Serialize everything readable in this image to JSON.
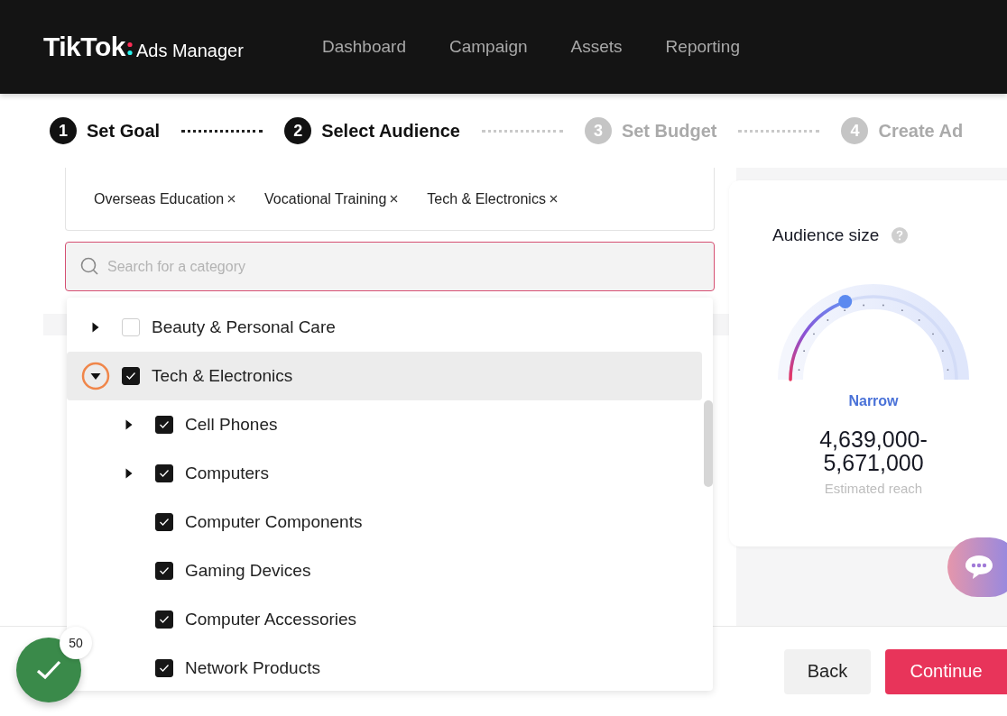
{
  "header": {
    "logo": "TikTok",
    "product": "Ads Manager",
    "nav": [
      {
        "label": "Dashboard"
      },
      {
        "label": "Campaign"
      },
      {
        "label": "Assets"
      },
      {
        "label": "Reporting"
      }
    ]
  },
  "steps": [
    {
      "number": "1",
      "label": "Set Goal",
      "active": true
    },
    {
      "number": "2",
      "label": "Select Audience",
      "active": true
    },
    {
      "number": "3",
      "label": "Set Budget",
      "active": false
    },
    {
      "number": "4",
      "label": "Create Ad",
      "active": false
    }
  ],
  "selected_tags": [
    "Overseas Education",
    "Vocational Training",
    "Tech & Electronics"
  ],
  "search": {
    "placeholder": "Search for a category"
  },
  "categories": [
    {
      "label": "Beauty & Personal Care",
      "kind": "group",
      "expanded": false,
      "checked": false,
      "selected": false
    },
    {
      "label": "Tech & Electronics",
      "kind": "group",
      "expanded": true,
      "checked": true,
      "selected": true,
      "children": [
        {
          "label": "Cell Phones",
          "kind": "group",
          "expanded": false,
          "checked": true,
          "selected": false
        },
        {
          "label": "Computers",
          "kind": "group",
          "expanded": false,
          "checked": true,
          "selected": false
        },
        {
          "label": "Computer Components",
          "kind": "leaf",
          "checked": true,
          "selected": false
        },
        {
          "label": "Gaming Devices",
          "kind": "leaf",
          "checked": true,
          "selected": false
        },
        {
          "label": "Computer Accessories",
          "kind": "leaf",
          "checked": true,
          "selected": false
        },
        {
          "label": "Network Products",
          "kind": "leaf",
          "checked": true,
          "selected": false
        }
      ]
    }
  ],
  "audience": {
    "title": "Audience size",
    "level": 0.33,
    "rating": "Narrow",
    "reach_lines": [
      "4,639,000-",
      "5,671,000"
    ],
    "reach_label": "Estimated reach"
  },
  "progress_badge": {
    "count": "50"
  },
  "buttons": [
    {
      "label": "Back",
      "kind": "secondary"
    },
    {
      "label": "Continue",
      "kind": "primary"
    }
  ]
}
